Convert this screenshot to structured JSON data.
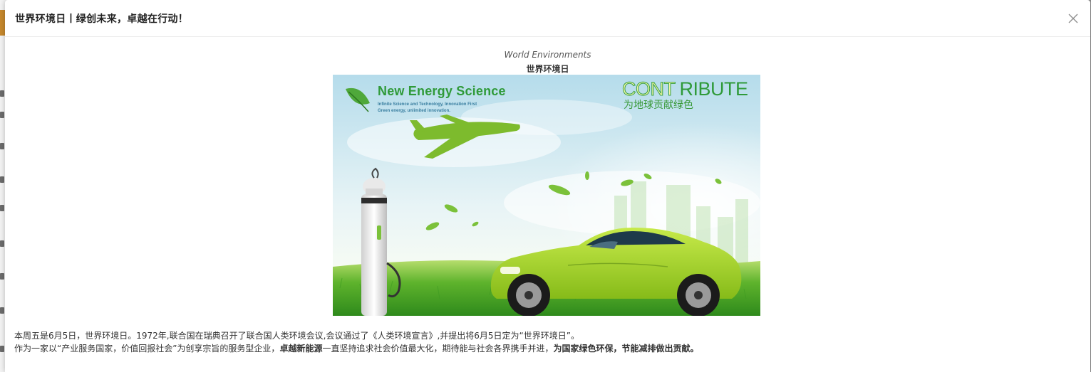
{
  "dialog": {
    "title": "世界环境日丨绿创未来，卓越在行动！",
    "close_icon": "close-icon"
  },
  "article": {
    "caption_en": "World Environments",
    "caption_zh": "世界环境日",
    "banner": {
      "title": "New Energy Science",
      "subtitle_line1": "Infinite Science and Technology, Innovation First",
      "subtitle_line2": "Green energy, unlimited innovation.",
      "contribute_part1": "CONT",
      "contribute_part2": "RIBUTE",
      "slogan": "为地球贡献绿色"
    },
    "paragraph1": "本周五是6月5日，世界环境日。1972年,联合国在瑞典召开了联合国人类环境会议,会议通过了《人类环境宣言》,并提出将6月5日定为“世界环境日”。",
    "paragraph2_part1": "作为一家以“产业服务国家，价值回报社会”为创享宗旨的服务型企业，",
    "paragraph2_bold1": "卓越新能源",
    "paragraph2_part2": "一直坚持追求社会价值最大化，期待能与社会各界携手并进，",
    "paragraph2_bold2": "为国家绿色环保，节能减排做出贡献。"
  },
  "colors": {
    "accent_green": "#2f9a39",
    "car_green": "#a3d42a",
    "background_overlay": "#8a8a8a"
  }
}
